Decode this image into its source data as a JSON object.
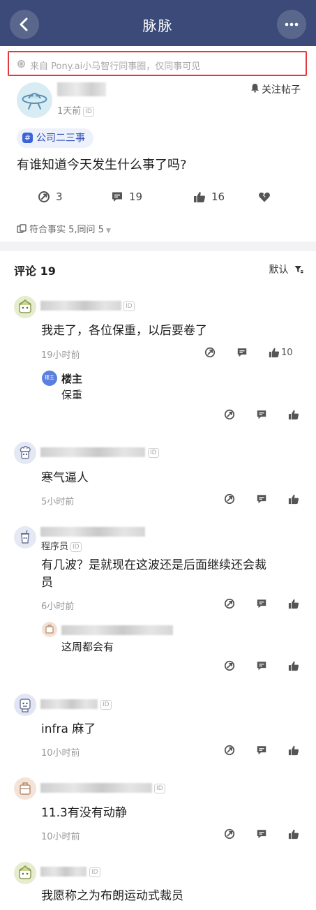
{
  "header": {
    "title": "脉脉",
    "back_icon": "chevron-left-icon",
    "more_icon": "more-dots-icon"
  },
  "source_notice": {
    "text": "来自 Pony.ai小马智行同事圈，仅同事可见",
    "highlight_color": "#e03a3a"
  },
  "post": {
    "time": "1天前",
    "id_badge": "ID",
    "follow_label": "关注帖子",
    "topic": "公司二三事",
    "question": "有谁知道今天发生什么事了吗?",
    "stats": {
      "share": "3",
      "comments": "19",
      "likes": "16"
    },
    "agree_text": "符合事实 5,同问 5"
  },
  "comments_section": {
    "title": "评论 19",
    "sort_label": "默认"
  },
  "comments": [
    {
      "text": "我走了，各位保重，以后要卷了",
      "time": "19小时前",
      "like_count": "10",
      "id_badge": "ID",
      "reply": {
        "badge": "楼主",
        "name": "楼主",
        "text": "保重"
      }
    },
    {
      "text": "寒气逼人",
      "time": "5小时前",
      "id_badge": "ID"
    },
    {
      "role": "程序员",
      "text_line1": "有几波？是就现在这波还是后面继续还会裁",
      "text_line2": "员",
      "time": "6小时前",
      "id_badge": "ID",
      "reply": {
        "text": "这周都会有"
      }
    },
    {
      "text": "infra 麻了",
      "time": "10小时前",
      "id_badge": "ID"
    },
    {
      "text": "11.3有没有动静",
      "time": "10小时前",
      "id_badge": "ID"
    },
    {
      "text": "我愿称之为布朗运动式裁员",
      "id_badge": "ID"
    }
  ],
  "colors": {
    "nav": "#3b4a78",
    "accent": "#3a63d6"
  }
}
